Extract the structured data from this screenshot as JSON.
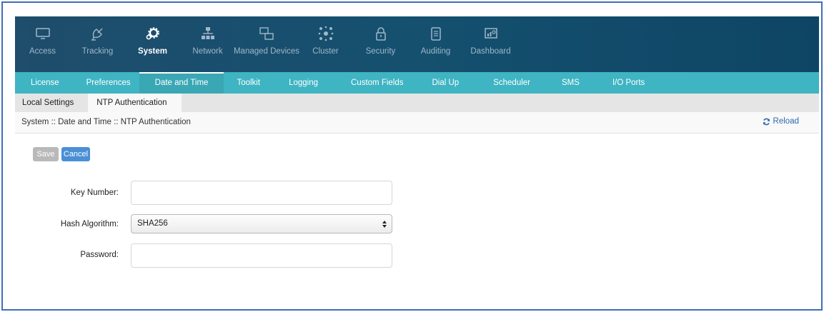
{
  "colors": {
    "topnav_bg": "#1a4d6e",
    "subnav_bg": "#3fb4c2",
    "accent_blue": "#4a8fd6",
    "border_blue": "#3f6fb8"
  },
  "topnav": {
    "items": [
      {
        "label": "Access",
        "icon": "monitor-icon"
      },
      {
        "label": "Tracking",
        "icon": "satellite-icon"
      },
      {
        "label": "System",
        "icon": "gear-icon"
      },
      {
        "label": "Network",
        "icon": "network-icon"
      },
      {
        "label": "Managed Devices",
        "icon": "devices-icon"
      },
      {
        "label": "Cluster",
        "icon": "cluster-icon"
      },
      {
        "label": "Security",
        "icon": "lock-icon"
      },
      {
        "label": "Auditing",
        "icon": "clipboard-icon"
      },
      {
        "label": "Dashboard",
        "icon": "dashboard-icon"
      }
    ],
    "active": "System"
  },
  "subnav": {
    "items": [
      "License",
      "Preferences",
      "Date and Time",
      "Toolkit",
      "Logging",
      "Custom Fields",
      "Dial Up",
      "Scheduler",
      "SMS",
      "I/O Ports"
    ],
    "active": "Date and Time"
  },
  "tabs": {
    "items": [
      "Local Settings",
      "NTP Authentication"
    ],
    "active": "NTP Authentication"
  },
  "breadcrumb": "System :: Date and Time :: NTP Authentication",
  "reload_label": "Reload",
  "buttons": {
    "save": "Save",
    "cancel": "Cancel"
  },
  "form": {
    "key_number": {
      "label": "Key Number:",
      "value": ""
    },
    "hash_algorithm": {
      "label": "Hash Algorithm:",
      "value": "SHA256"
    },
    "password": {
      "label": "Password:",
      "value": ""
    }
  }
}
